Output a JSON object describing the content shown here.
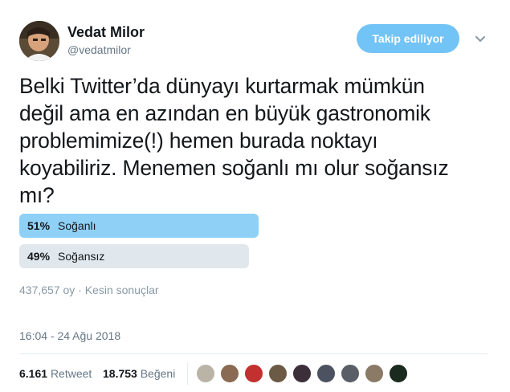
{
  "user": {
    "display_name": "Vedat Milor",
    "handle": "@vedatmilor",
    "follow_label": "Takip ediliyor"
  },
  "tweet": {
    "lines": [
      "Belki Twitter’da dünyayı kurtarmak mümkün",
      "değil ama en azından en büyük gastronomik",
      "problemimize(!) hemen burada noktayı",
      "koyabiliriz. Menemen soğanlı mı olur soğansız",
      "mı?"
    ]
  },
  "poll": {
    "options": [
      {
        "percent_label": "51%",
        "label": "Soğanlı",
        "percent": 51,
        "winner": true
      },
      {
        "percent_label": "49%",
        "label": "Soğansız",
        "percent": 49,
        "winner": false
      }
    ],
    "meta": "437,657 oy · Kesin sonuçlar"
  },
  "timestamp": "16:04 - 24 Ağu 2018",
  "stats": {
    "retweets_count": "6.161",
    "retweets_label": "Retweet",
    "likes_count": "18.753",
    "likes_label": "Beğeni"
  },
  "liker_avatars": [
    "liker-1",
    "liker-2",
    "liker-3",
    "liker-4",
    "liker-5",
    "liker-6",
    "liker-7",
    "liker-8",
    "liker-9"
  ],
  "colors": {
    "accent": "#1da1f2",
    "winner_bar": "#8fd0f7",
    "loser_bar": "#e1e8ed"
  }
}
